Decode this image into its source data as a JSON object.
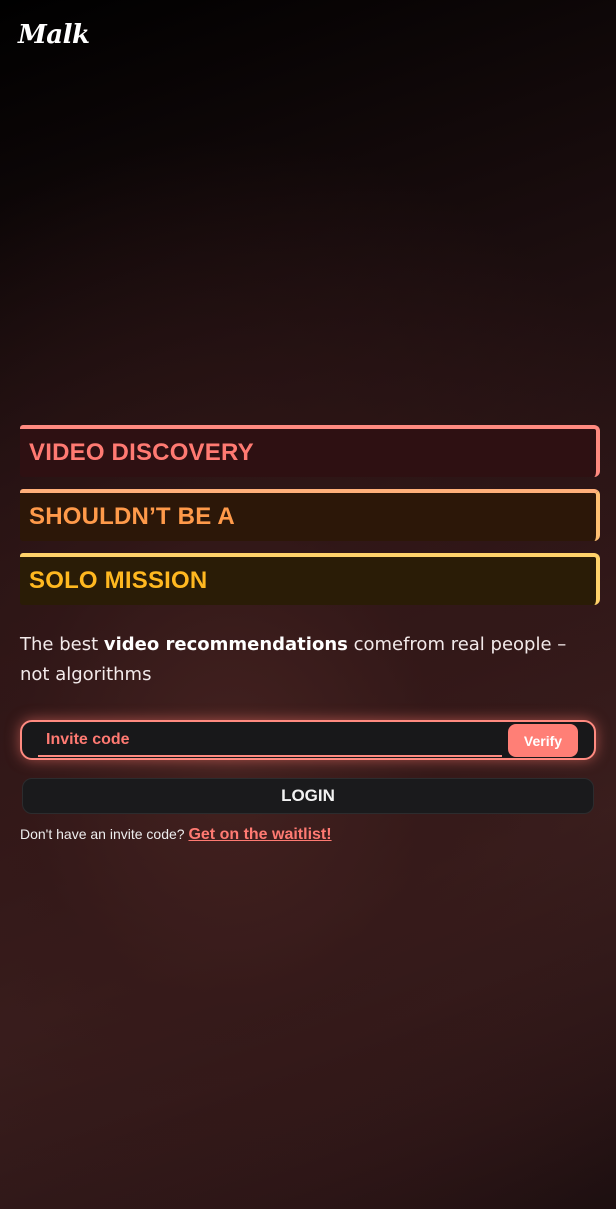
{
  "app": {
    "logo_text": "Malk"
  },
  "hero": {
    "lines": [
      "VIDEO DISCOVERY",
      "SHOULDN’T BE A",
      "SOLO MISSION"
    ],
    "colors": [
      "#ff7a72",
      "#ff9a4a",
      "#ffb820"
    ]
  },
  "tagline": {
    "part1": "The best ",
    "bold": "video recommendations",
    "part2": " comefrom real people – not algorithms"
  },
  "invite": {
    "placeholder": "Invite code",
    "value": "",
    "verify_label": "Verify"
  },
  "login": {
    "label": "LOGIN"
  },
  "waitlist": {
    "prompt": "Don't have an invite code? ",
    "link_label": "Get on the waitlist!"
  },
  "theme": {
    "accent": "#ff7f76"
  }
}
